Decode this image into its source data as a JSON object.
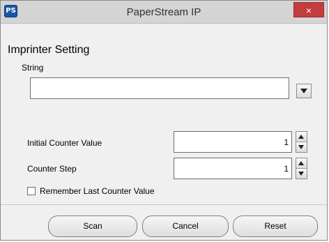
{
  "window": {
    "app_icon_text": "PS",
    "title": "PaperStream IP",
    "close_label": "×"
  },
  "form": {
    "heading": "Imprinter Setting",
    "string_label": "String",
    "string_value": "",
    "initial_counter_label": "Initial Counter Value",
    "initial_counter_value": "1",
    "counter_step_label": "Counter Step",
    "counter_step_value": "1",
    "remember_label": "Remember Last Counter Value",
    "remember_checked": false
  },
  "buttons": {
    "scan": "Scan",
    "cancel": "Cancel",
    "reset": "Reset"
  },
  "icons": {
    "dropdown": "chevron-down-icon",
    "spin_up": "spin-up-icon",
    "spin_down": "spin-down-icon"
  },
  "colors": {
    "close_button": "#c43c3c",
    "app_icon": "#1a55a8",
    "window_background": "#f0f0f0"
  }
}
